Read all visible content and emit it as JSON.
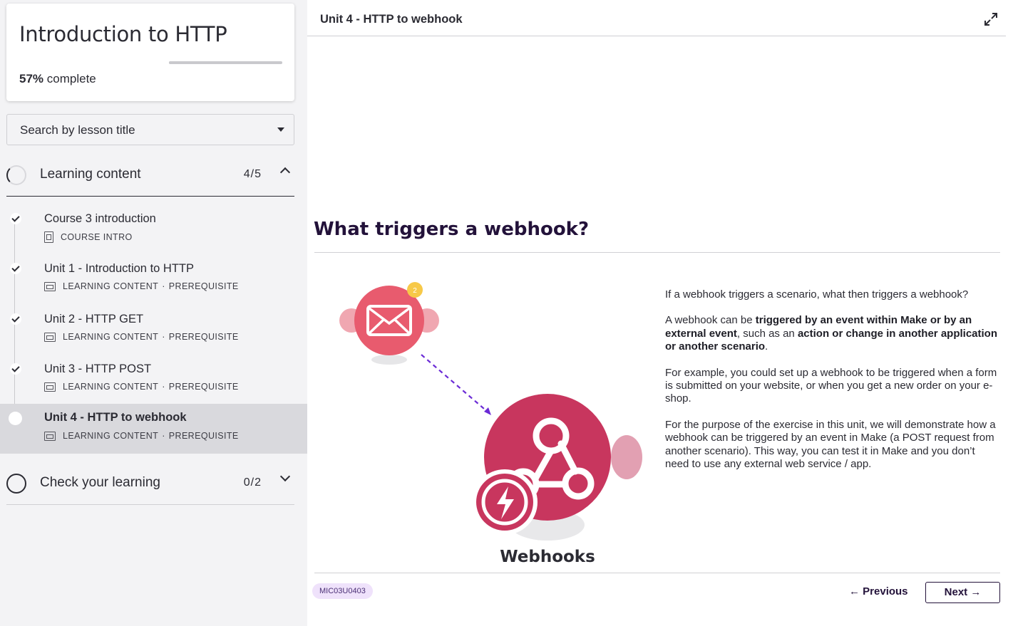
{
  "course": {
    "title": "Introduction to HTTP",
    "progress_percent": 57,
    "progress_value": "57%",
    "progress_suffix": "complete"
  },
  "search": {
    "placeholder": "Search by lesson title"
  },
  "sections": [
    {
      "title": "Learning content",
      "count": "4/5",
      "expanded": true
    },
    {
      "title": "Check your learning",
      "count": "0/2",
      "expanded": false
    }
  ],
  "lessons": [
    {
      "title": "Course 3 introduction",
      "type": "COURSE INTRO",
      "tag": "",
      "done": true,
      "active": false,
      "icon": "document-icon"
    },
    {
      "title": "Unit 1 - Introduction to HTTP",
      "type": "LEARNING CONTENT",
      "tag": "PREREQUISITE",
      "done": true,
      "active": false,
      "icon": "media-icon"
    },
    {
      "title": "Unit 2 - HTTP GET",
      "type": "LEARNING CONTENT",
      "tag": "PREREQUISITE",
      "done": true,
      "active": false,
      "icon": "media-icon"
    },
    {
      "title": "Unit 3 - HTTP POST",
      "type": "LEARNING CONTENT",
      "tag": "PREREQUISITE",
      "done": true,
      "active": false,
      "icon": "media-icon"
    },
    {
      "title": "Unit 4 - HTTP to webhook",
      "type": "LEARNING CONTENT",
      "tag": "PREREQUISITE",
      "done": false,
      "active": true,
      "icon": "media-icon"
    }
  ],
  "separator": "·",
  "main": {
    "header_title": "Unit 4 - HTTP to webhook",
    "headline": "What triggers a webhook?",
    "illustration": {
      "badge_count": "2",
      "caption": "Webhooks"
    },
    "paragraphs": [
      [
        {
          "t": "If a webhook triggers a scenario, what then triggers a webhook?",
          "b": false
        }
      ],
      [
        {
          "t": "A webhook can be ",
          "b": false
        },
        {
          "t": "triggered by an event within Make or by an external event",
          "b": true
        },
        {
          "t": ", such as an ",
          "b": false
        },
        {
          "t": "action or change in another application or another scenario",
          "b": true
        },
        {
          "t": ".",
          "b": false
        }
      ],
      [
        {
          "t": "For example, you could set up a webhook to be triggered when a form is submitted on your website, or when you get a new order on your e-shop.",
          "b": false
        }
      ],
      [
        {
          "t": "For the purpose of the exercise in this unit, we will demonstrate how a webhook can be triggered by an event in Make (a POST request from another scenario). This way, you can test it in Make and you don’t need to use any external web service / app.",
          "b": false
        }
      ]
    ],
    "code": "MIC03U0403",
    "prev_label": "← Previous",
    "next_label": "Next →"
  },
  "colors": {
    "accent": "#23123a",
    "email_module": "#e85b6e",
    "webhook_module": "#c8365e",
    "badge": "#f7c948",
    "code_bg": "#efe2fb"
  }
}
